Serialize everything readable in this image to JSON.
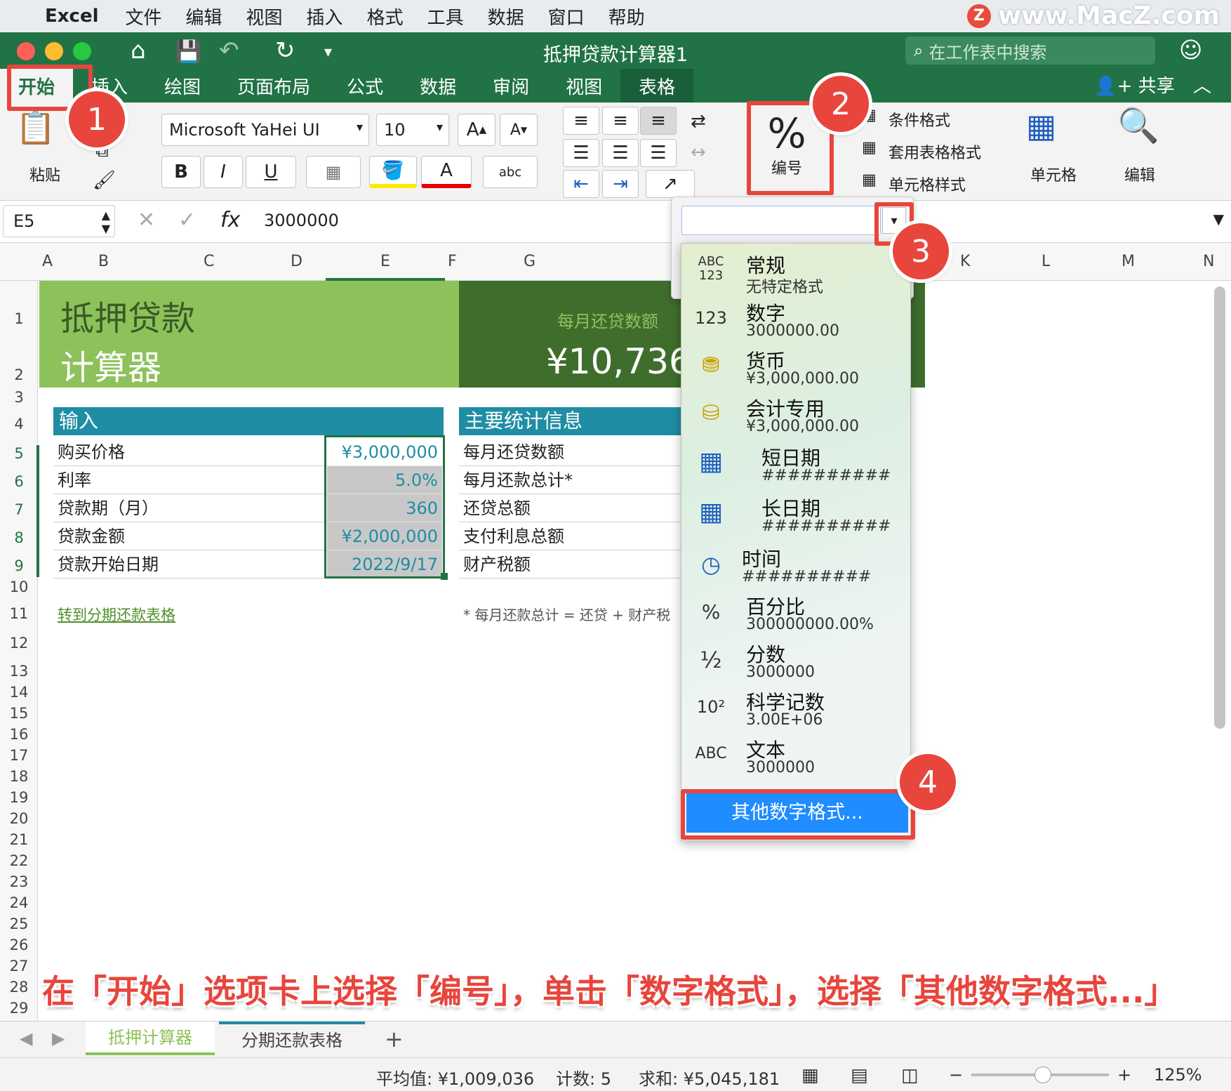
{
  "menubar": {
    "app": "Excel",
    "items": [
      "文件",
      "编辑",
      "视图",
      "插入",
      "格式",
      "工具",
      "数据",
      "窗口",
      "帮助"
    ],
    "watermark": "www.MacZ.com",
    "watermark_logo": "Z"
  },
  "window": {
    "title": "抵押贷款计算器1",
    "search_placeholder": "在工作表中搜索",
    "share": "共享"
  },
  "tabs": [
    "开始",
    "插入",
    "绘图",
    "页面布局",
    "公式",
    "数据",
    "审阅",
    "视图",
    "表格"
  ],
  "ribbon": {
    "paste": "粘贴",
    "font_name": "Microsoft YaHei UI",
    "font_size": "10",
    "bold": "B",
    "italic": "I",
    "underline": "U",
    "number_label": "编号",
    "number_icon": "%",
    "cond_format": "条件格式",
    "table_format": "套用表格格式",
    "cell_style": "单元格样式",
    "cells": "单元格",
    "edit": "编辑"
  },
  "formula_bar": {
    "name_box": "E5",
    "fx": "fx",
    "value": "3000000"
  },
  "columns": [
    "A",
    "B",
    "C",
    "D",
    "E",
    "F",
    "G",
    "K",
    "L",
    "M",
    "N"
  ],
  "rows": [
    "1",
    "2",
    "3",
    "4",
    "5",
    "6",
    "7",
    "8",
    "9",
    "10",
    "11",
    "12",
    "13",
    "14",
    "15",
    "16",
    "17",
    "18",
    "19",
    "20",
    "21",
    "22",
    "23",
    "24",
    "25",
    "26",
    "27",
    "28",
    "29"
  ],
  "sheet": {
    "title_line1": "抵押贷款",
    "title_line2": "计算器",
    "monthly_label": "每月还贷数额",
    "monthly_value": "¥10,736",
    "input_header": "输入",
    "inputs": [
      {
        "label": "购买价格",
        "value": "¥3,000,000"
      },
      {
        "label": "利率",
        "value": "5.0%"
      },
      {
        "label": "贷款期（月）",
        "value": "360"
      },
      {
        "label": "贷款金额",
        "value": "¥2,000,000"
      },
      {
        "label": "贷款开始日期",
        "value": "2022/9/17"
      }
    ],
    "stats_header": "主要统计信息",
    "stats": [
      "每月还贷数额",
      "每月还款总计*",
      "还贷总额",
      "支付利息总额",
      "财产税额"
    ],
    "link": "转到分期还款表格",
    "footnote": "* 每月还款总计 = 还贷 + 财产税"
  },
  "number_formats": [
    {
      "icon": "ABC 123",
      "name": "常规",
      "example": "无特定格式"
    },
    {
      "icon": "123",
      "name": "数字",
      "example": "3000000.00"
    },
    {
      "icon": "coins-icon",
      "name": "货币",
      "example": "¥3,000,000.00"
    },
    {
      "icon": "calculator-icon",
      "name": "会计专用",
      "example": "¥3,000,000.00"
    },
    {
      "icon": "calendar-icon",
      "name": "短日期",
      "example": "##########"
    },
    {
      "icon": "calendar-icon",
      "name": "长日期",
      "example": "##########"
    },
    {
      "icon": "clock-icon",
      "name": "时间",
      "example": "##########"
    },
    {
      "icon": "%",
      "name": "百分比",
      "example": "300000000.00%"
    },
    {
      "icon": "½",
      "name": "分数",
      "example": "3000000"
    },
    {
      "icon": "10²",
      "name": "科学记数",
      "example": "3.00E+06"
    },
    {
      "icon": "ABC",
      "name": "文本",
      "example": "3000000"
    }
  ],
  "more_formats": "其他数字格式...",
  "badges": [
    "1",
    "2",
    "3",
    "4"
  ],
  "caption": "在「开始」选项卡上选择「编号」，单击「数字格式」，选择「其他数字格式...」",
  "sheet_tabs": [
    "抵押计算器",
    "分期还款表格"
  ],
  "add_sheet": "+",
  "status": {
    "avg": "平均值: ¥1,009,036",
    "count": "计数: 5",
    "sum": "求和: ¥5,045,181",
    "zoom": "125%"
  },
  "colors": {
    "excel_green": "#217346",
    "accent_red": "#e8453c",
    "teal": "#1f8da4",
    "menu_blue": "#1f8cff"
  }
}
